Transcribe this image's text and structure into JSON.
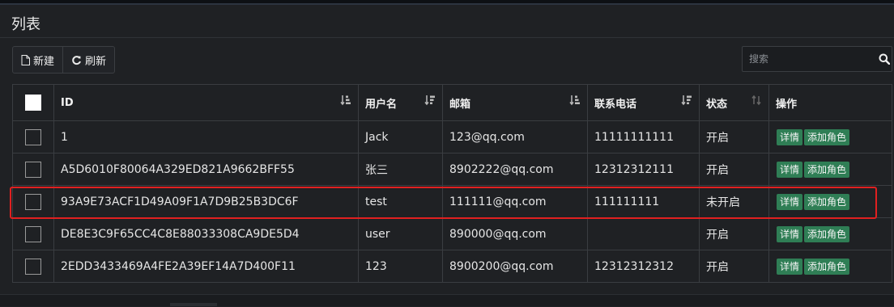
{
  "panel": {
    "title": "列表"
  },
  "toolbar": {
    "new_label": "新建",
    "refresh_label": "刷新"
  },
  "search": {
    "placeholder": "搜索",
    "value": ""
  },
  "table": {
    "columns": [
      "ID",
      "用户名",
      "邮箱",
      "联系电话",
      "状态",
      "操作"
    ],
    "rows": [
      {
        "id": "1",
        "username": "Jack",
        "email": "123@qq.com",
        "phone": "11111111111",
        "status": "开启"
      },
      {
        "id": "A5D6010F80064A329ED821A9662BFF55",
        "username": "张三",
        "email": "8902222@qq.com",
        "phone": "12312312111",
        "status": "开启"
      },
      {
        "id": "93A9E73ACF1D49A09F1A7D9B25B3DC6F",
        "username": "test",
        "email": "111111@qq.com",
        "phone": "111111111",
        "status": "未开启"
      },
      {
        "id": "DE8E3C9F65CC4C8E88033308CA9DE5D4",
        "username": "user",
        "email": "890000@qq.com",
        "phone": "",
        "status": "开启"
      },
      {
        "id": "2EDD3433469A4FE2A39EF14A7D400F11",
        "username": "123",
        "email": "8900200@qq.com",
        "phone": "12312312312",
        "status": "开启"
      }
    ],
    "action_detail": "详情",
    "action_add_role": "添加角色"
  },
  "colors": {
    "action_button": "#2f7e55",
    "highlight": "#e02020",
    "background": "#1f2124"
  }
}
